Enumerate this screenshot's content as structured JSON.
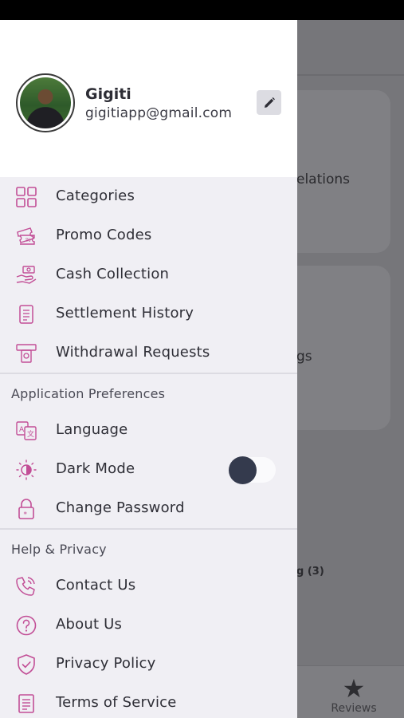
{
  "background_app": {
    "card1_text": "elations",
    "card2_text": "gs",
    "list_text": "g (3)",
    "tab_reviews": "Reviews",
    "tab_reviews_icon": "star-icon"
  },
  "profile": {
    "name": "Gigiti",
    "email": "gigitiapp@gmail.com",
    "edit_icon": "pencil-icon"
  },
  "menu_main": [
    {
      "label": "Categories",
      "icon": "grid-icon"
    },
    {
      "label": "Promo Codes",
      "icon": "ticket-icon"
    },
    {
      "label": "Cash Collection",
      "icon": "cash-hand-icon"
    },
    {
      "label": "Settlement History",
      "icon": "receipt-icon"
    },
    {
      "label": "Withdrawal Requests",
      "icon": "withdrawal-icon"
    }
  ],
  "section_preferences": {
    "title": "Application Preferences",
    "items": [
      {
        "label": "Language",
        "icon": "translate-icon"
      },
      {
        "label": "Dark Mode",
        "icon": "dark-mode-icon",
        "toggle_on": false
      },
      {
        "label": "Change Password",
        "icon": "lock-icon"
      }
    ]
  },
  "section_help": {
    "title": "Help & Privacy",
    "items": [
      {
        "label": "Contact Us",
        "icon": "phone-icon"
      },
      {
        "label": "About Us",
        "icon": "question-icon"
      },
      {
        "label": "Privacy Policy",
        "icon": "shield-check-icon"
      },
      {
        "label": "Terms of Service",
        "icon": "document-icon"
      }
    ]
  },
  "colors": {
    "accent_icon": "#c24e96",
    "drawer_bg": "#f0eff4",
    "toggle_knob": "#343a4d"
  }
}
